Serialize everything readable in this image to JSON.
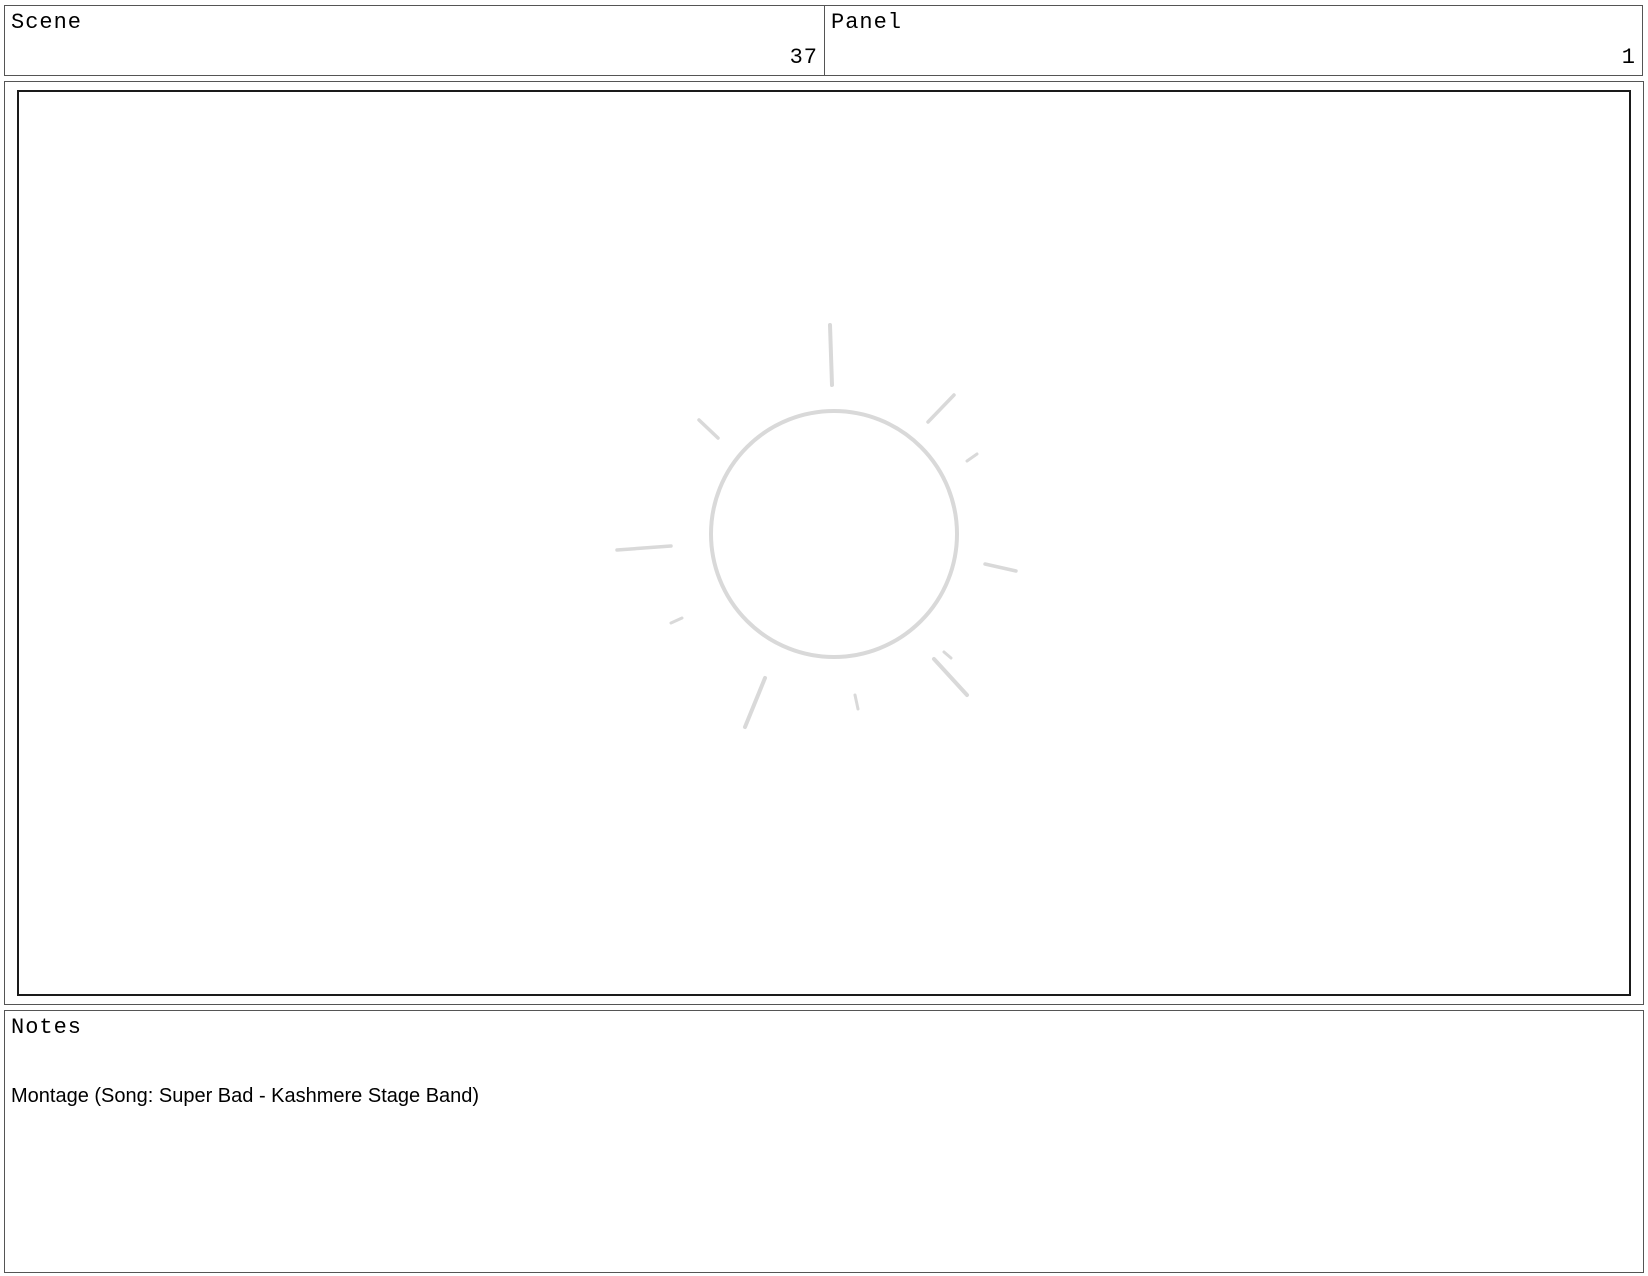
{
  "scene": {
    "label": "Scene",
    "value": "37"
  },
  "panel": {
    "label": "Panel",
    "value": "1"
  },
  "frame": {
    "sketch": "sun-sketch-icon",
    "sketch_color": "#d9d9d9"
  },
  "notes": {
    "label": "Notes",
    "text": "Montage (Song: Super Bad - Kashmere Stage Band)"
  }
}
